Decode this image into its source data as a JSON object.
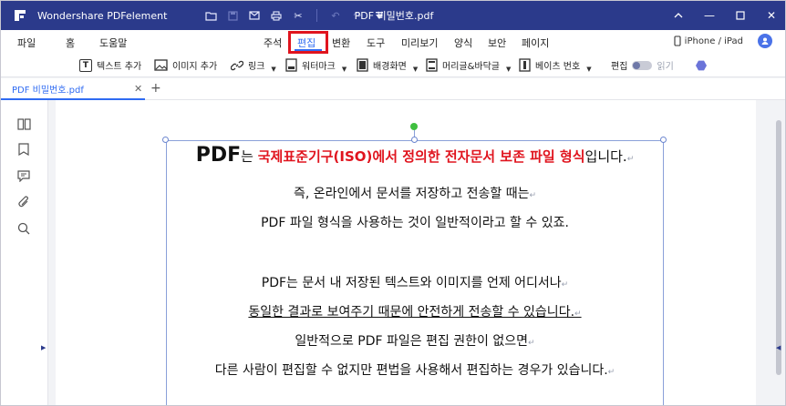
{
  "titlebar": {
    "app_name": "Wondershare PDFelement",
    "document_title": "PDF 비밀번호.pdf",
    "bg_color": "#2b3a8b"
  },
  "menu": {
    "items": [
      "파일",
      "홈",
      "도움말",
      "주석",
      "편집",
      "변환",
      "도구",
      "미리보기",
      "양식",
      "보안",
      "페이지"
    ],
    "active": "편집",
    "device_label": "iPhone / iPad"
  },
  "ribbon": {
    "add_text": "텍스트 추가",
    "add_image": "이미지 추가",
    "link": "링크",
    "watermark": "워터마크",
    "background": "배경화면",
    "header_footer": "머리글&바닥글",
    "bates": "베이츠 번호",
    "edit": "편집",
    "read": "읽기"
  },
  "tabs": {
    "doc_tab": "PDF 비밀번호.pdf"
  },
  "document": {
    "line1_prefix_big": "PDF",
    "line1_prefix": "는 ",
    "line1_red": "국제표준기구(ISO)에서 정의한 전자문서 보존 파일 형식",
    "line1_suffix": "입니다.",
    "line2": "즉, 온라인에서 문서를 저장하고 전송할 때는",
    "line3": "PDF 파일 형식을 사용하는 것이 일반적이라고 할 수 있죠.",
    "line4": "PDF는 문서 내 저장된 텍스트와 이미지를 언제 어디서나",
    "line5": "동일한 결과로 보여주기 때문에 안전하게 전송할 수 있습니다.",
    "line6": "일반적으로 PDF 파일은 편집 권한이 없으면",
    "line7": "다른 사람이 편집할 수 없지만 편법을 사용해서 편집하는 경우가 있습니다.",
    "para_mark": "↵"
  }
}
